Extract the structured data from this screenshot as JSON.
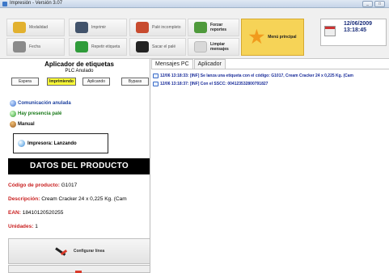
{
  "window": {
    "title": "Impresión - Versión 3.07",
    "controls": [
      "_",
      "□"
    ]
  },
  "toolbar": {
    "buttons": [
      {
        "label": "Modalidad",
        "icon": "switch-icon",
        "color": "#e2b12f"
      },
      {
        "label": "Imprimir",
        "icon": "printer-icon",
        "color": "#42536b"
      },
      {
        "label": "Palé incompleto",
        "icon": "pallet-icon",
        "color": "#c84b2f"
      },
      {
        "label": "Forzar reportes",
        "icon": "report-icon",
        "color": "#4f9a3c"
      },
      {
        "label": "Fecha",
        "icon": "date-icon",
        "color": "#8a8a8a"
      },
      {
        "label": "Repetir etiqueta",
        "icon": "repeat-icon",
        "color": "#2f9b3a"
      },
      {
        "label": "Sacar el palé",
        "icon": "forward-icon",
        "color": "#222222"
      },
      {
        "label": "Limpiar mensajes",
        "icon": "clear-icon",
        "color": "#d8d8d8"
      }
    ],
    "main_menu_label": "Menú principal",
    "date": "12/06/2009",
    "time": "13:18:45"
  },
  "left": {
    "title": "Aplicador de etiquetas",
    "plc_status": "PLC Anulado",
    "modes": [
      "Espera",
      "Imprimiendo",
      "Aplicando",
      "Bypass"
    ],
    "active_mode": "Imprimiendo",
    "status": {
      "communication": "Comunicación anulada",
      "pallet_present": "Hay presencia palé",
      "manual": "Manual"
    },
    "printer_status": "Impresora: Lanzando",
    "product_header": "DATOS DEL PRODUCTO",
    "product": {
      "code_label": "Código de producto:",
      "code_value": "G1017",
      "desc_label": "Descripción:",
      "desc_value": "Cream Cracker 24 x 0,225 Kg. (Cam",
      "ean_label": "EAN:",
      "ean_value": "18410120520255",
      "units_label": "Unidades:",
      "units_value": "1"
    },
    "configure_label": "Configurar línea"
  },
  "right": {
    "tabs": [
      "Mensajes PC",
      "Aplicador"
    ],
    "active_tab": "Mensajes PC",
    "messages": [
      "12/06 13:18:33: [INF] Se lanza una etiqueta con el código: G1017, Cream Cracker 24 x 0,225 Kg. (Cam",
      "12/06 13:18:37: [INF] Con el SSCC: 004123532800791827"
    ]
  },
  "colors": {
    "accent_yellow": "#ffff38",
    "main_menu_bg": "#f6d357",
    "label_red": "#c91f1f",
    "log_blue": "#1a2d9a"
  }
}
